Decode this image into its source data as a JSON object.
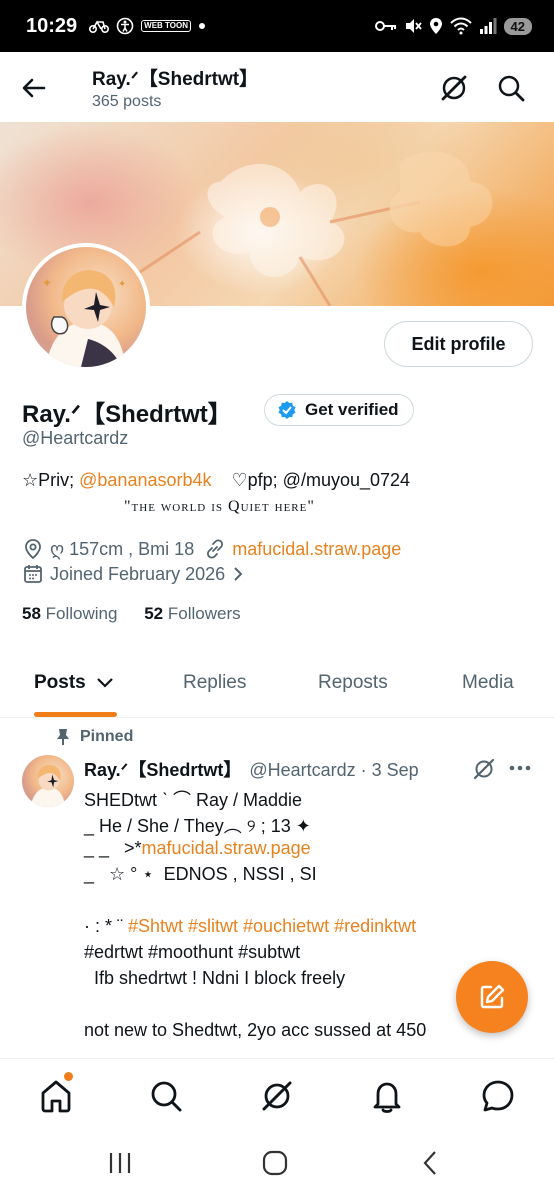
{
  "status_bar": {
    "time": "10:29",
    "left_icons": [
      "bicycle-icon",
      "accessibility-icon",
      "webtoon-icon",
      "dot-icon"
    ],
    "webtoon_label": "WEB TOON",
    "battery": "42"
  },
  "header": {
    "title": "Ray.ᐟ【Shedrtwt】",
    "subtitle": "365 posts"
  },
  "profile": {
    "edit_button": "Edit profile",
    "display_name": "Ray.ᐟ【Shedrtwt】",
    "get_verified": "Get verified",
    "handle": "@Heartcardz",
    "bio_prefix": "☆Priv; ",
    "bio_link": "@bananasorb4k",
    "bio_suffix": "    ♡pfp; @/muyou_0724",
    "bio_quote": "\"the world is Quiet here\"",
    "location": "ღ 157cm , Bmi 18",
    "website": "mafucidal.straw.page",
    "joined": "Joined February 2026",
    "following_count": "58",
    "following_label": "Following",
    "followers_count": "52",
    "followers_label": "Followers"
  },
  "tabs": [
    {
      "label": "Posts"
    },
    {
      "label": "Replies"
    },
    {
      "label": "Reposts"
    },
    {
      "label": "Media"
    }
  ],
  "tweet": {
    "pinned_label": "Pinned",
    "name": "Ray.ᐟ【Shedrtwt】",
    "meta": "@Heartcardz · 3 Sep",
    "line1": "SHEDtwt ˋ ⌒ Ray  / Maddie",
    "line2": "_ He / She / They︵ ୨ ; 13 ✦",
    "line3_prefix": "_ _   >*",
    "line3_link": "mafucidal.straw.page",
    "line4": "_   ☆ ° ⋆  EDNOS , NSSI , SI",
    "line5_prefix": "· : * ¨ ",
    "line5_tags": "#Shtwt #slitwt #ouchietwt #redinktwt",
    "line6_tags": "#edrtwt #moothunt #subtwt",
    "line7": "  Ifb shedrtwt ! Ndni I block freely",
    "line8": "not new to Shedtwt, 2yo acc sussed at 450"
  },
  "colors": {
    "accent": "#f07f1a",
    "text": "#0f1419",
    "muted": "#536471",
    "verified": "#1d9bf0"
  }
}
